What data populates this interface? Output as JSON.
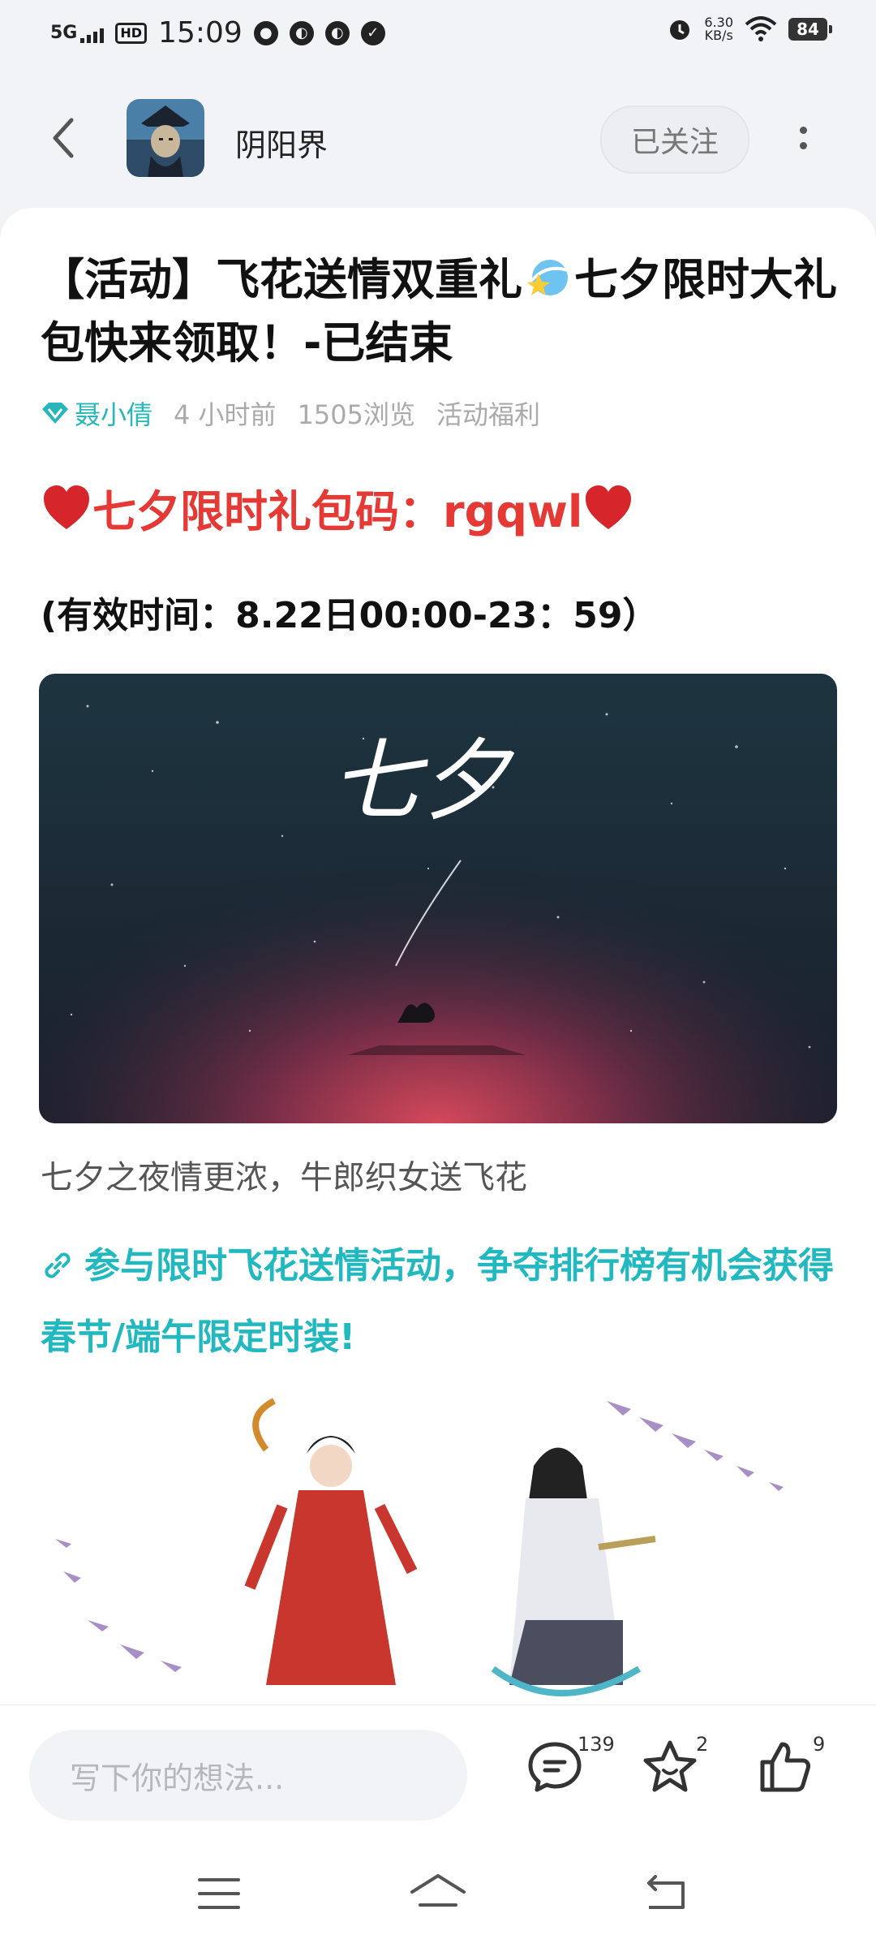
{
  "status_bar": {
    "network": "5G",
    "hd": "HD",
    "time": "15:09",
    "speed_value": "6.30",
    "speed_unit": "KB/s",
    "battery": "84"
  },
  "header": {
    "forum_name": "阴阳界",
    "follow_label": "已关注"
  },
  "post": {
    "title_part1": "【活动】飞花送情双重礼",
    "title_part2": "七夕限时大礼包快来领取！-已结束",
    "author": "聂小倩",
    "time": "4 小时前",
    "views": "1505浏览",
    "category": "活动福利",
    "code_line": "七夕限时礼包码：rgqwl",
    "valid_time": "(有效时间：8.22日00:00-23：59）",
    "banner_text": "七夕",
    "caption": "七夕之夜情更浓，牛郎织女送飞花",
    "link_text": "参与限时飞花送情活动，争夺排行榜有机会获得春节/端午限定时装!"
  },
  "bottom_bar": {
    "comment_placeholder": "写下你的想法...",
    "comment_count": "139",
    "favorite_count": "2",
    "like_count": "9"
  },
  "colors": {
    "accent_teal": "#22b8c0",
    "code_red": "#e53935",
    "background": "#f2f3f6"
  },
  "icons": [
    "back-arrow-icon",
    "more-vertical-icon",
    "diamond-icon",
    "heart-icon",
    "link-icon",
    "comment-icon",
    "star-icon",
    "thumbs-up-icon",
    "menu-icon",
    "home-icon",
    "back-icon"
  ]
}
